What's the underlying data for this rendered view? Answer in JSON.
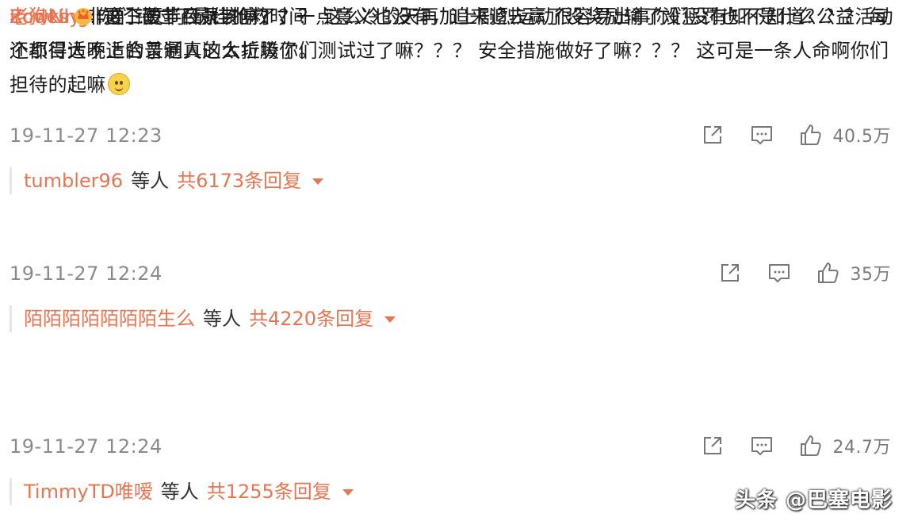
{
  "comments": [
    {
      "username": "ZcwNly",
      "text": ":非要三更半夜录制嘛？？？ 这么冷的天再加上剧烈运动很容易出事你们没有知不知道？？？ 每个项目适不适合普通人这么折腾你们测试过了嘛？？？ 安全措施做好了嘛？？？ 这可是一条人命啊你们担待的起嘛",
      "emoji": "smile-emoji",
      "timestamp": "19-11-27 12:23",
      "likes": "40.5万",
      "reply_user": "tumbler96",
      "reply_etc": "等人",
      "reply_total": "共6173条回复"
    },
    {
      "username": "老狗king",
      "text": ":你们错过了最佳抢救时间",
      "timestamp": "19-11-27 12:24",
      "likes": "35万",
      "reply_user": "陌陌陌陌陌陌陌生么",
      "reply_etc": "等人",
      "reply_total": "共4220条回复"
    },
    {
      "username": "Rodes",
      "badge": "crown-badge",
      "text": ":这个破节目就该停了，一点意义也没有，追来追去赢了没奖励输了没惩罚也不是什么公益活动还都得大晚上的录制真的太垃圾了。",
      "timestamp": "19-11-27 12:24",
      "likes": "24.7万",
      "reply_user": "TimmyTD唯嗳",
      "reply_etc": "等人",
      "reply_total": "共1255条回复"
    }
  ],
  "icons": {
    "share": "share-icon",
    "comment": "comment-icon",
    "like": "thumbs-up-icon",
    "expand": "caret-down-icon"
  },
  "watermark": "头条 @巴塞电影",
  "colors": {
    "username": "#eb7350",
    "meta": "#8a8a8a",
    "text": "#1a1a1a"
  }
}
